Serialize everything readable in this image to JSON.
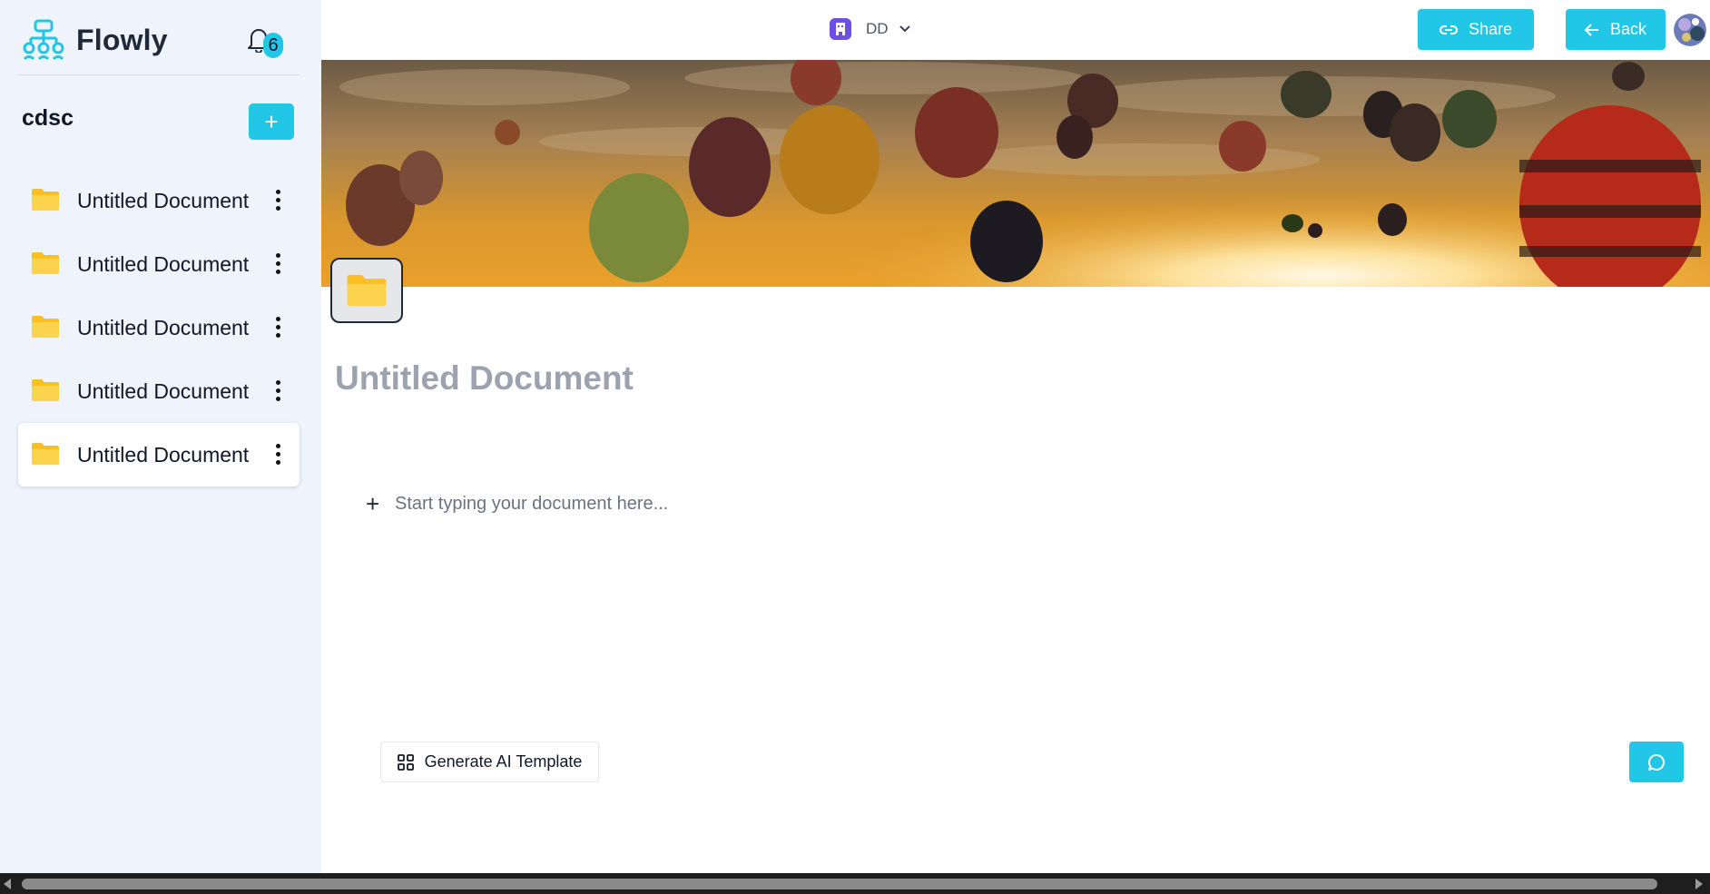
{
  "app": {
    "name": "Flowly"
  },
  "notifications": {
    "count": "6"
  },
  "sidebar": {
    "workspace": "cdsc",
    "add_label": "+",
    "documents": [
      {
        "label": "Untitled Document",
        "active": false
      },
      {
        "label": "Untitled Document",
        "active": false
      },
      {
        "label": "Untitled Document",
        "active": false
      },
      {
        "label": "Untitled Document",
        "active": false
      },
      {
        "label": "Untitled Document",
        "active": true
      }
    ]
  },
  "topbar": {
    "workspace_switcher": "DD",
    "share_label": "Share",
    "back_label": "Back"
  },
  "document": {
    "title": "Untitled Document",
    "placeholder": "Start typing your document here...",
    "add_block_label": "+"
  },
  "actions": {
    "ai_template_label": "Generate AI Template"
  },
  "colors": {
    "accent": "#22c6e6",
    "sidebar_bg": "#eef3fc",
    "workspace_icon": "#6d4fe6",
    "folder": "#fbbf24"
  },
  "icons": {
    "logo": "flowchart-logo-icon",
    "bell": "bell-icon",
    "folder": "folder-icon",
    "more": "more-vertical-icon",
    "share": "link-icon",
    "back": "arrow-left-icon",
    "chat": "chat-bubble-icon",
    "template": "grid-icon"
  }
}
